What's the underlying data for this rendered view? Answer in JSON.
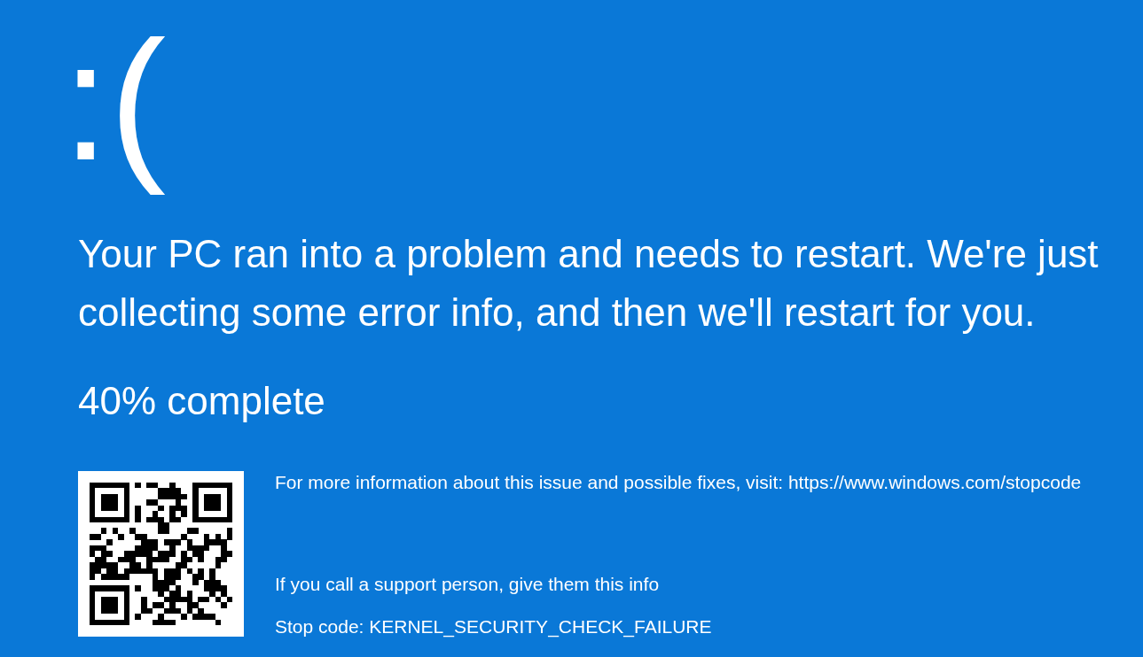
{
  "emoticon": ":(",
  "message": "Your PC ran into a problem and needs to restart. We're just collecting some error info, and then we'll restart for you.",
  "progress": "40% complete",
  "details": {
    "more_info": "For more information about this issue and possible fixes, visit: https://www.windows.com/stopcode",
    "support_hint": "If you call a support person, give them this info",
    "stop_code": "Stop code: KERNEL_SECURITY_CHECK_FAILURE"
  }
}
